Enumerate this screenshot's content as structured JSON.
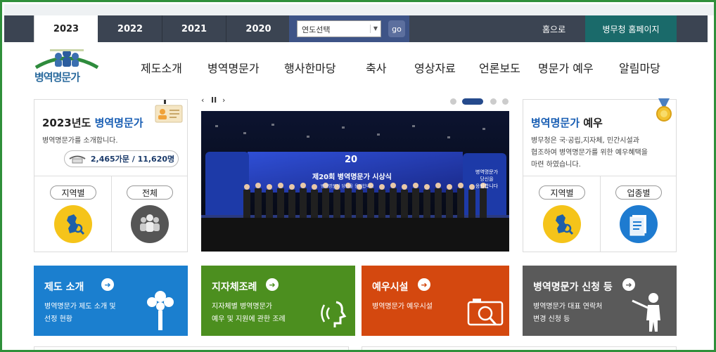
{
  "topbar": {
    "year_tabs": [
      "2023",
      "2022",
      "2021",
      "2020"
    ],
    "year_select": {
      "value": "연도선택"
    },
    "go_label": "go",
    "home_label": "홈으로",
    "mma_label": "병무청 홈페이지"
  },
  "logo": {
    "text": "병역명문가"
  },
  "nav": {
    "items": [
      "제도소개",
      "병역명문가",
      "행사한마당",
      "축사",
      "영상자료",
      "언론보도",
      "명문가 예우",
      "알림마당"
    ]
  },
  "left_card": {
    "title_year": "2023년도 ",
    "title_hl": "병역명문가",
    "desc": "병역명문가를 소개합니다.",
    "counter": "2,465가문 / 11,620명",
    "btn_region": "지역별",
    "btn_all": "전체"
  },
  "slider": {
    "pause_label": "II",
    "prev_label": "‹",
    "next_label": "›",
    "banner_title": "제20회 병역명문가 시상식",
    "banner_sub": "병역명문가 당신을 응원합니다",
    "badge": "20",
    "side_text": "병역명문가\n당신을\n응원합니다"
  },
  "right_card": {
    "title_hl": "병역명문가",
    "title_rest": " 예우",
    "desc_l1": "병무청은 국·공립,지자체, 민간시설과",
    "desc_l2": "협조하여 병역명문가를 위한 예우혜택을",
    "desc_l3": "마련 하였습니다.",
    "btn_region": "지역별",
    "btn_industry": "업종별"
  },
  "tiles": [
    {
      "title": "제도 소개",
      "desc1": "병역명문가 제도 소개 및",
      "desc2": "선정 현황",
      "color": "#1b7fcf"
    },
    {
      "title": "지자체조례",
      "desc1": "지자체별 병역명문가",
      "desc2": "예우 및 지원에 관한 조례",
      "color": "#4c8f1f"
    },
    {
      "title": "예우시설",
      "desc1": "병역명문가 예우시설",
      "desc2": "",
      "color": "#d4480f"
    },
    {
      "title": "병역명문가 신청 등",
      "desc1": "병역명문가 대표 연락처",
      "desc2": "변경 신청 등",
      "color": "#5a5a5a"
    }
  ],
  "colors": {
    "accent": "#1a5fb4",
    "topbar": "#3b4452",
    "frame": "#2f8f3a"
  },
  "icons": [
    "map-search-icon",
    "people-icon",
    "medal-icon",
    "id-card-icon",
    "document-icon",
    "tree-icon",
    "speaking-icon",
    "camera-search-icon",
    "presenter-icon"
  ]
}
